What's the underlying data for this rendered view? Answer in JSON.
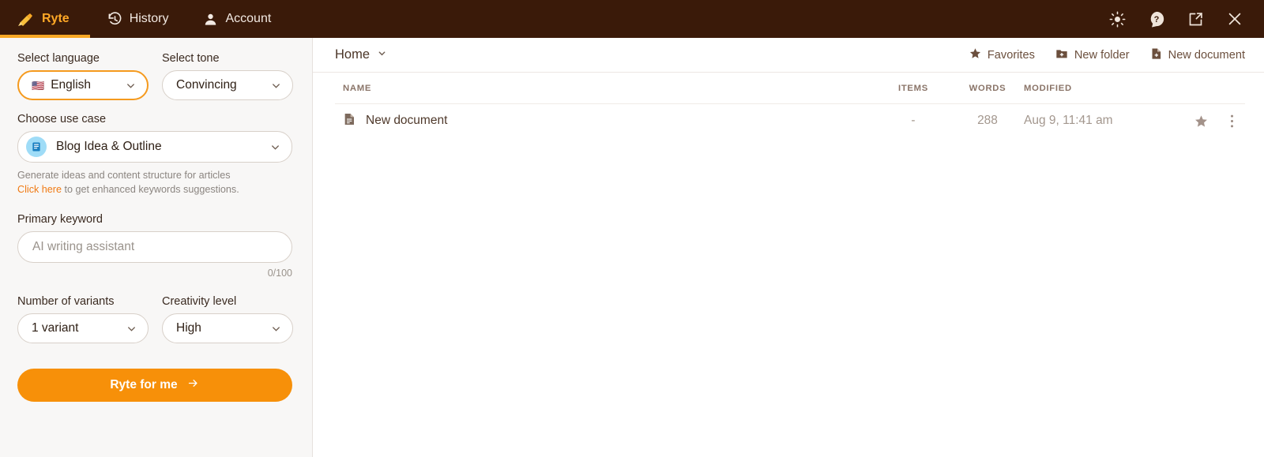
{
  "topbar": {
    "tabs": [
      {
        "label": "Ryte",
        "icon": "ryte-logo-icon",
        "active": true
      },
      {
        "label": "History",
        "icon": "history-clock-icon",
        "active": false
      },
      {
        "label": "Account",
        "icon": "person-icon",
        "active": false
      }
    ],
    "right_icons": [
      "brightness-sun-icon",
      "help-question-icon",
      "open-external-icon",
      "close-icon"
    ],
    "background": "#3a1a09",
    "active_color": "#ffa826",
    "underline_color": "#f9a825"
  },
  "sidebar": {
    "language": {
      "label": "Select language",
      "value": "English",
      "flag": "🇺🇸",
      "focused": true
    },
    "tone": {
      "label": "Select tone",
      "value": "Convincing"
    },
    "use_case": {
      "label": "Choose use case",
      "value": "Blog Idea & Outline",
      "description": "Generate ideas and content structure for articles",
      "link_text": "Click here",
      "link_suffix": " to get enhanced keywords suggestions.",
      "link_color": "#f07a13"
    },
    "primary_keyword": {
      "label": "Primary keyword",
      "value": "",
      "placeholder": "AI writing assistant",
      "counter": "0/100"
    },
    "variants": {
      "label": "Number of variants",
      "value": "1 variant"
    },
    "creativity": {
      "label": "Creativity level",
      "value": "High"
    },
    "cta": {
      "label": "Ryte for me",
      "color": "#f79009"
    }
  },
  "main": {
    "breadcrumb": "Home",
    "actions": [
      {
        "label": "Favorites",
        "icon": "star-icon"
      },
      {
        "label": "New folder",
        "icon": "folder-plus-icon"
      },
      {
        "label": "New document",
        "icon": "file-plus-icon"
      }
    ],
    "table": {
      "columns": [
        "NAME",
        "ITEMS",
        "WORDS",
        "MODIFIED"
      ],
      "rows": [
        {
          "name": "New document",
          "icon": "document-icon",
          "items": "-",
          "words": "288",
          "modified": "Aug 9, 11:41 am",
          "favorite_icon": "star-icon",
          "menu_icon": "more-vertical-icon"
        }
      ]
    }
  }
}
